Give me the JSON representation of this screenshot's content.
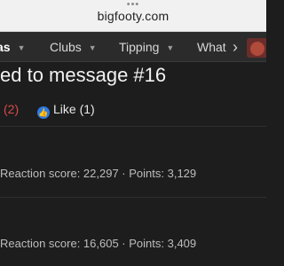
{
  "browser": {
    "dots": "•••",
    "url": "bigfooty.com"
  },
  "nav": {
    "items": [
      {
        "label": "as",
        "active": true
      },
      {
        "label": "Clubs",
        "active": false
      },
      {
        "label": "Tipping",
        "active": false
      },
      {
        "label": "What",
        "active": false
      }
    ],
    "caret": "▼",
    "next": "›"
  },
  "post": {
    "title": "ed to message #16",
    "reaction_count": "(2)",
    "like_label": "Like (1)"
  },
  "members": [
    {
      "stats": "Reaction score: 22,297 · Points: 3,129"
    },
    {
      "stats": "Reaction score: 16,605 · Points: 3,409"
    }
  ]
}
